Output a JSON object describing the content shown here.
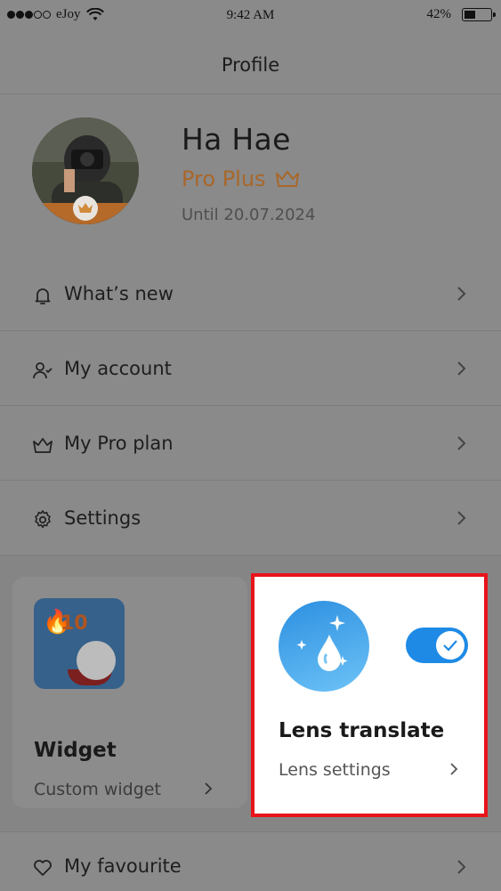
{
  "status_bar": {
    "carrier": "eJoy",
    "time": "9:42 AM",
    "battery": "42%"
  },
  "header": {
    "title": "Profile"
  },
  "profile": {
    "name": "Ha Hae",
    "plan": "Pro Plus",
    "until": "Until 20.07.2024"
  },
  "menu": {
    "items": [
      {
        "label": "What’s new",
        "icon": "bell-icon"
      },
      {
        "label": "My account",
        "icon": "user-check-icon"
      },
      {
        "label": "My Pro plan",
        "icon": "crown-outline-icon"
      },
      {
        "label": "Settings",
        "icon": "gear-icon"
      }
    ]
  },
  "cards": {
    "widget": {
      "title": "Widget",
      "subtitle": "Custom widget",
      "streak": "10"
    },
    "lens": {
      "title": "Lens translate",
      "subtitle": "Lens settings",
      "enabled": true
    }
  },
  "favourite": {
    "label": "My favourite",
    "icon": "heart-icon"
  },
  "colors": {
    "accent_blue": "#1e8ae6",
    "plan_orange": "#a8672a",
    "highlight_red": "#e8141a"
  }
}
